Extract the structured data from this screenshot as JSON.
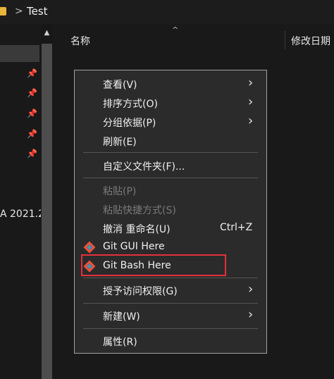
{
  "titlebar": {
    "breadcrumb_separator": ">",
    "folder_name": "Test"
  },
  "nav": {
    "truncated_label": "A 2021.2"
  },
  "header": {
    "col_name": "名称",
    "col_date": "修改日期"
  },
  "menu": {
    "items": [
      {
        "label": "查看(V)",
        "submenu": true
      },
      {
        "label": "排序方式(O)",
        "submenu": true
      },
      {
        "label": "分组依据(P)",
        "submenu": true
      },
      {
        "label": "刷新(E)"
      },
      {
        "label": "自定义文件夹(F)..."
      },
      {
        "label": "粘贴(P)",
        "disabled": true
      },
      {
        "label": "粘贴快捷方式(S)",
        "disabled": true
      },
      {
        "label": "撤消 重命名(U)",
        "shortcut": "Ctrl+Z"
      },
      {
        "label": "Git GUI Here",
        "icon": "git-icon"
      },
      {
        "label": "Git Bash Here",
        "icon": "git-icon",
        "highlighted": true
      },
      {
        "label": "授予访问权限(G)",
        "submenu": true
      },
      {
        "label": "新建(W)",
        "submenu": true
      },
      {
        "label": "属性(R)"
      }
    ],
    "submenu_arrow": "›"
  },
  "colors": {
    "background": "#191919",
    "menu_bg": "#2b2b2b",
    "highlight_border": "#e5303b",
    "git_orange": "#f05033"
  }
}
